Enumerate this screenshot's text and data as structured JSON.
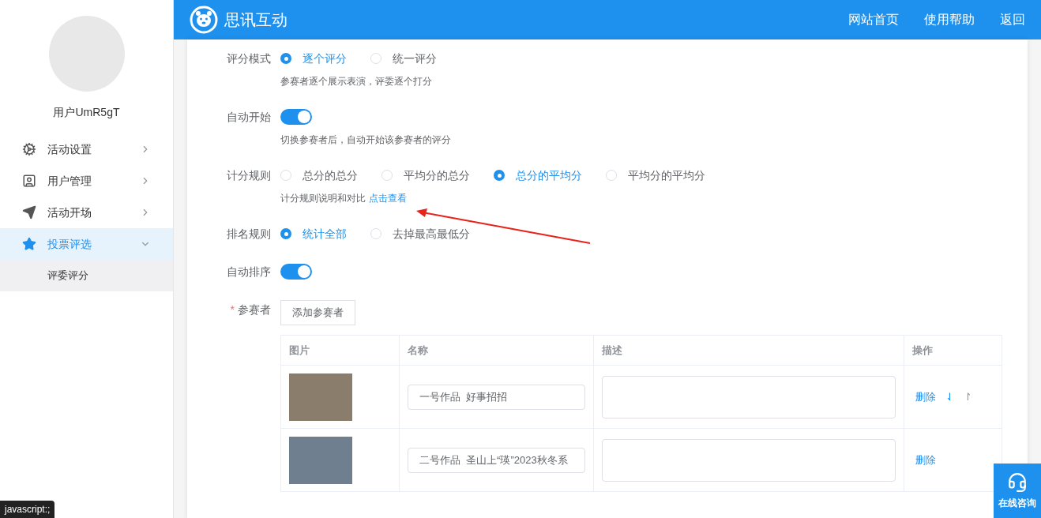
{
  "sidebar": {
    "username": "用户UmR5gT",
    "items": [
      {
        "label": "活动设置",
        "selected": false,
        "expanded": false
      },
      {
        "label": "用户管理",
        "selected": false,
        "expanded": false
      },
      {
        "label": "活动开场",
        "selected": false,
        "expanded": false
      },
      {
        "label": "投票评选",
        "selected": true,
        "expanded": true,
        "children": [
          {
            "label": "评委评分",
            "selected": false
          }
        ]
      }
    ]
  },
  "header": {
    "title": "思讯互动",
    "links": [
      "网站首页",
      "使用帮助",
      "返回"
    ]
  },
  "form": [
    {
      "kind": "radio",
      "label": "评分模式",
      "options": [
        {
          "label": "逐个评分",
          "selected": true
        },
        {
          "label": "统一评分",
          "selected": false
        }
      ],
      "hint": "参赛者逐个展示表演，评委逐个打分"
    },
    {
      "kind": "switch",
      "label": "自动开始",
      "on": true,
      "hint": "切换参赛者后，自动开始该参赛者的评分"
    },
    {
      "kind": "radio",
      "label": "计分规则",
      "options": [
        {
          "label": "总分的总分",
          "selected": false
        },
        {
          "label": "平均分的总分",
          "selected": false
        },
        {
          "label": "总分的平均分",
          "selected": true
        },
        {
          "label": "平均分的平均分",
          "selected": false
        }
      ],
      "hint": "计分规则说明和对比",
      "hint_link": "点击查看"
    },
    {
      "kind": "radio",
      "label": "排名规则",
      "options": [
        {
          "label": "统计全部",
          "selected": true
        },
        {
          "label": "去掉最高最低分",
          "selected": false
        }
      ]
    },
    {
      "kind": "switch",
      "label": "自动排序",
      "on": true
    },
    {
      "kind": "participants",
      "label": "参赛者",
      "required_mark": "*",
      "button": "添加参赛者"
    }
  ],
  "table": {
    "columns": [
      "图片",
      "名称",
      "描述",
      "操作"
    ],
    "rows": [
      {
        "name": "一号作品  好事招招",
        "actions": [
          "删除",
          "⇃",
          "↾"
        ]
      },
      {
        "name": "二号作品  圣山上“瑛”2023秋冬系",
        "actions": [
          "删除"
        ]
      }
    ]
  },
  "chat_widget": {
    "label": "在线咨询"
  },
  "status_tooltip": "javascript:;"
}
